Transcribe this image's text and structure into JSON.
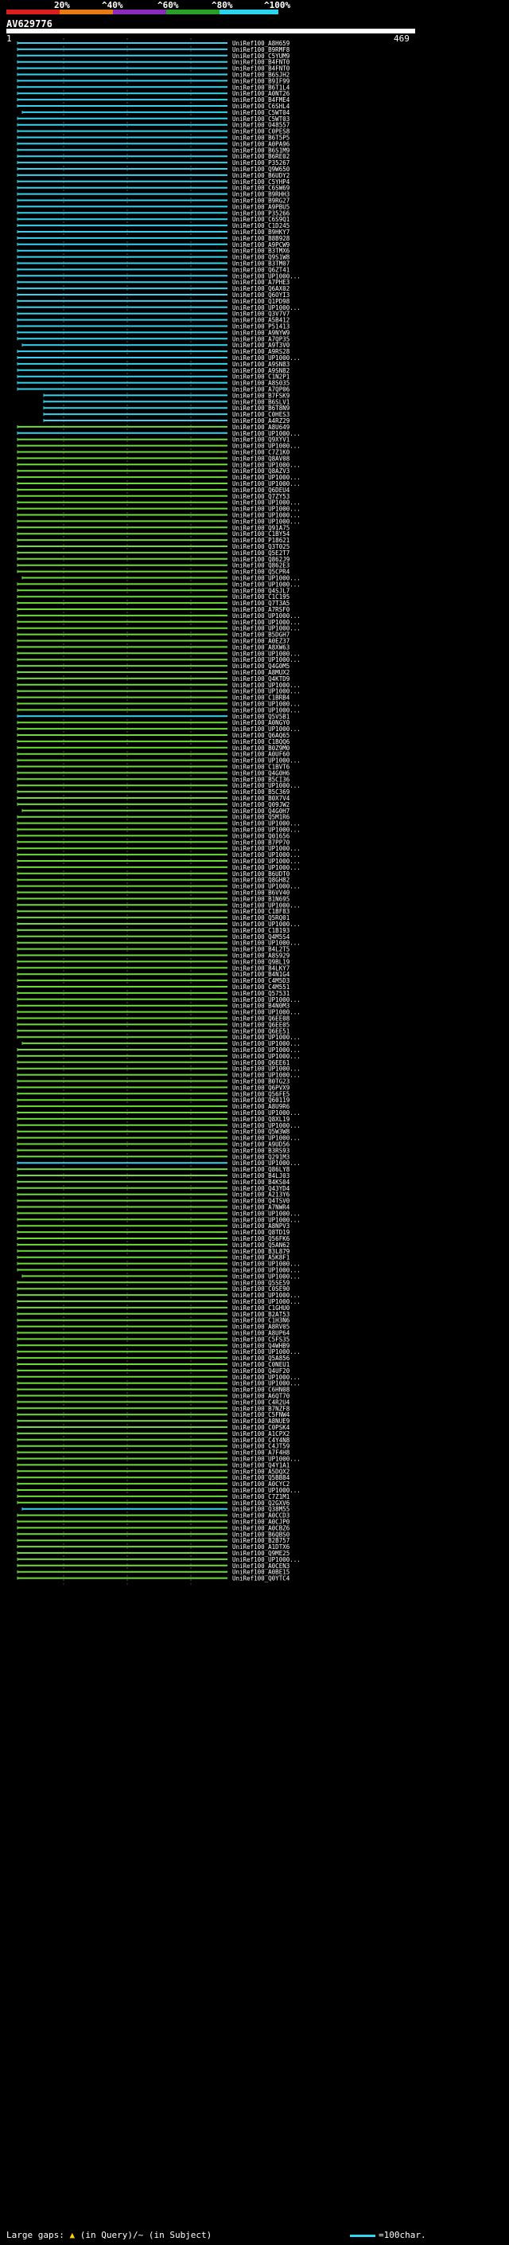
{
  "legend": {
    "labels": [
      "20%",
      "^40%",
      "^60%",
      "^80%",
      "^100%"
    ],
    "colors": [
      "#dc1e1e",
      "#e87a12",
      "#8b2bbd",
      "#28a028",
      "#2ad4ee"
    ]
  },
  "query": {
    "id": "AV629776",
    "start": "1",
    "end": "469"
  },
  "hit_colors": {
    "blue": "#36d3ef",
    "green": "#6cdc36"
  },
  "hits": [
    {
      "label": "UniRef100_A8H659",
      "color": "blue"
    },
    {
      "label": "UniRef100_B9RMF8",
      "color": "blue"
    },
    {
      "label": "UniRef100_C5YUM9",
      "color": "blue"
    },
    {
      "label": "UniRef100_B4FNT0",
      "color": "blue"
    },
    {
      "label": "UniRef100_B4FNT0",
      "color": "blue"
    },
    {
      "label": "UniRef100_B6SJH2",
      "color": "blue"
    },
    {
      "label": "UniRef100_B9IF99",
      "color": "blue"
    },
    {
      "label": "UniRef100_B6T1L4",
      "color": "blue"
    },
    {
      "label": "UniRef100_A0NT26",
      "color": "blue"
    },
    {
      "label": "UniRef100_B4FME4",
      "color": "blue"
    },
    {
      "label": "UniRef100_C6SHL4",
      "color": "blue"
    },
    {
      "label": "UniRef100_C5WT04",
      "color": "blue"
    },
    {
      "label": "UniRef100_C5WT03",
      "color": "blue"
    },
    {
      "label": "UniRef100_O48557",
      "color": "blue"
    },
    {
      "label": "UniRef100_C0PES8",
      "color": "blue"
    },
    {
      "label": "UniRef100_B6T5P5",
      "color": "blue"
    },
    {
      "label": "UniRef100_A0PA96",
      "color": "blue"
    },
    {
      "label": "UniRef100_B6S1M9",
      "color": "blue"
    },
    {
      "label": "UniRef100_B6RE02",
      "color": "blue"
    },
    {
      "label": "UniRef100_P35267",
      "color": "blue"
    },
    {
      "label": "UniRef100_Q9W650",
      "color": "blue"
    },
    {
      "label": "UniRef100_B6UDY2",
      "color": "blue"
    },
    {
      "label": "UniRef100_C5YHP4",
      "color": "blue"
    },
    {
      "label": "UniRef100_C6SW69",
      "color": "blue"
    },
    {
      "label": "UniRef100_B9RHH3",
      "color": "blue"
    },
    {
      "label": "UniRef100_B9RG27",
      "color": "blue"
    },
    {
      "label": "UniRef100_A9PBU5",
      "color": "blue"
    },
    {
      "label": "UniRef100_P35266",
      "color": "blue"
    },
    {
      "label": "UniRef100_C6S9Q1",
      "color": "blue"
    },
    {
      "label": "UniRef100_C1D245",
      "color": "blue"
    },
    {
      "label": "UniRef100_B9HKY7",
      "color": "blue"
    },
    {
      "label": "UniRef100_B8B928",
      "color": "blue"
    },
    {
      "label": "UniRef100_A9PCW9",
      "color": "blue"
    },
    {
      "label": "UniRef100_B3TMX6",
      "color": "blue"
    },
    {
      "label": "UniRef100_Q9S1W8",
      "color": "blue"
    },
    {
      "label": "UniRef100_B3TM07",
      "color": "blue"
    },
    {
      "label": "UniRef100_Q6ZT41",
      "color": "blue"
    },
    {
      "label": "UniRef100_UP1000...",
      "color": "blue"
    },
    {
      "label": "UniRef100_A7PHE3",
      "color": "blue"
    },
    {
      "label": "UniRef100_Q6AX02",
      "color": "blue"
    },
    {
      "label": "UniRef100_Q6OYI3",
      "color": "blue"
    },
    {
      "label": "UniRef100_Q1PD98",
      "color": "blue"
    },
    {
      "label": "UniRef100_UP1000...",
      "color": "blue"
    },
    {
      "label": "UniRef100_Q3V7V7",
      "color": "blue"
    },
    {
      "label": "UniRef100_A5B412",
      "color": "blue"
    },
    {
      "label": "UniRef100_P51413",
      "color": "blue"
    },
    {
      "label": "UniRef100_A9NYW9",
      "color": "blue"
    },
    {
      "label": "UniRef100_A7QP35",
      "color": "blue"
    },
    {
      "label": "UniRef100_A9T3V0",
      "color": "blue"
    },
    {
      "label": "UniRef100_A9RS28",
      "color": "blue"
    },
    {
      "label": "UniRef100_UP1000...",
      "color": "blue"
    },
    {
      "label": "UniRef100_A9SN83",
      "color": "blue"
    },
    {
      "label": "UniRef100_A9SN82",
      "color": "blue"
    },
    {
      "label": "UniRef100_C1N2P1",
      "color": "blue"
    },
    {
      "label": "UniRef100_A8S035",
      "color": "blue"
    },
    {
      "label": "UniRef100_A7QP06",
      "color": "blue"
    },
    {
      "label": "UniRef100_B7FSK9",
      "color": "blue"
    },
    {
      "label": "UniRef100_B6SLV1",
      "color": "blue"
    },
    {
      "label": "UniRef100_B6T8N9",
      "color": "blue"
    },
    {
      "label": "UniRef100_C0HES3",
      "color": "blue"
    },
    {
      "label": "UniRef100_A4RZ29",
      "color": "blue"
    },
    {
      "label": "UniRef100_A8U649",
      "color": "green"
    },
    {
      "label": "UniRef100_UP1000...",
      "color": "blue"
    },
    {
      "label": "UniRef100_Q9XYV1",
      "color": "green"
    },
    {
      "label": "UniRef100_UP1000...",
      "color": "green"
    },
    {
      "label": "UniRef100_C7Z1K0",
      "color": "green"
    },
    {
      "label": "UniRef100_Q8AV08",
      "color": "green"
    },
    {
      "label": "UniRef100_UP1000...",
      "color": "green"
    },
    {
      "label": "UniRef100_Q8AZV3",
      "color": "green"
    },
    {
      "label": "UniRef100_UP1000...",
      "color": "green"
    },
    {
      "label": "UniRef100_UP1000...",
      "color": "green"
    },
    {
      "label": "UniRef100_Q6DEU4",
      "color": "green"
    },
    {
      "label": "UniRef100_Q7ZY53",
      "color": "green"
    },
    {
      "label": "UniRef100_UP1000...",
      "color": "green"
    },
    {
      "label": "UniRef100_UP1000...",
      "color": "green"
    },
    {
      "label": "UniRef100_UP1000...",
      "color": "green"
    },
    {
      "label": "UniRef100_UP1000...",
      "color": "green"
    },
    {
      "label": "UniRef100_Q91A75",
      "color": "green"
    },
    {
      "label": "UniRef100_C1BY54",
      "color": "green"
    },
    {
      "label": "UniRef100_P18621",
      "color": "green"
    },
    {
      "label": "UniRef100_Q3T025",
      "color": "green"
    },
    {
      "label": "UniRef100_Q5E2T7",
      "color": "green"
    },
    {
      "label": "UniRef100_Q862J9",
      "color": "green"
    },
    {
      "label": "UniRef100_Q862E3",
      "color": "green"
    },
    {
      "label": "UniRef100_Q5CPR4",
      "color": "green"
    },
    {
      "label": "UniRef100_UP1000...",
      "color": "green"
    },
    {
      "label": "UniRef100_UP1000...",
      "color": "green"
    },
    {
      "label": "UniRef100_Q4SJL7",
      "color": "green"
    },
    {
      "label": "UniRef100_C1C195",
      "color": "green"
    },
    {
      "label": "UniRef100_Q7T3A5",
      "color": "green"
    },
    {
      "label": "UniRef100_A7RSF0",
      "color": "green"
    },
    {
      "label": "UniRef100_UP1000...",
      "color": "green"
    },
    {
      "label": "UniRef100_UP1000...",
      "color": "green"
    },
    {
      "label": "UniRef100_UP1000...",
      "color": "green"
    },
    {
      "label": "UniRef100_B5DGH7",
      "color": "green"
    },
    {
      "label": "UniRef100_A0EZ37",
      "color": "green"
    },
    {
      "label": "UniRef100_A8XW63",
      "color": "green"
    },
    {
      "label": "UniRef100_UP1000...",
      "color": "green"
    },
    {
      "label": "UniRef100_UP1000...",
      "color": "green"
    },
    {
      "label": "UniRef100_Q4G0M5",
      "color": "green"
    },
    {
      "label": "UniRef100_A8MUX2",
      "color": "green"
    },
    {
      "label": "UniRef100_Q4KTD9",
      "color": "green"
    },
    {
      "label": "UniRef100_UP1000...",
      "color": "green"
    },
    {
      "label": "UniRef100_UP1000...",
      "color": "green"
    },
    {
      "label": "UniRef100_C1BRB4",
      "color": "green"
    },
    {
      "label": "UniRef100_UP1000...",
      "color": "green"
    },
    {
      "label": "UniRef100_UP1000...",
      "color": "green"
    },
    {
      "label": "UniRef100_Q5V5B1",
      "color": "blue"
    },
    {
      "label": "UniRef100_A0NGY0",
      "color": "green"
    },
    {
      "label": "UniRef100_UP1000...",
      "color": "green"
    },
    {
      "label": "UniRef100_Q6AQ65",
      "color": "green"
    },
    {
      "label": "UniRef100_C1BQQ6",
      "color": "green"
    },
    {
      "label": "UniRef100_B0Z9M0",
      "color": "green"
    },
    {
      "label": "UniRef100_A0UF60",
      "color": "green"
    },
    {
      "label": "UniRef100_UP1000...",
      "color": "green"
    },
    {
      "label": "UniRef100_C1BVT6",
      "color": "green"
    },
    {
      "label": "UniRef100_Q4G0H6",
      "color": "green"
    },
    {
      "label": "UniRef100_B5CI36",
      "color": "green"
    },
    {
      "label": "UniRef100_UP1000...",
      "color": "green"
    },
    {
      "label": "UniRef100_B5C369",
      "color": "green"
    },
    {
      "label": "UniRef100_B0X7V4",
      "color": "green"
    },
    {
      "label": "UniRef100_Q09JW2",
      "color": "green"
    },
    {
      "label": "UniRef100_Q4G0H7",
      "color": "green"
    },
    {
      "label": "UniRef100_Q5M1R6",
      "color": "green"
    },
    {
      "label": "UniRef100_UP1000...",
      "color": "green"
    },
    {
      "label": "UniRef100_UP1000...",
      "color": "green"
    },
    {
      "label": "UniRef100_Q01656",
      "color": "green"
    },
    {
      "label": "UniRef100_B7PP70",
      "color": "green"
    },
    {
      "label": "UniRef100_UP1000...",
      "color": "green"
    },
    {
      "label": "UniRef100_UP1000...",
      "color": "green"
    },
    {
      "label": "UniRef100_UP1000...",
      "color": "green"
    },
    {
      "label": "UniRef100_UP1000...",
      "color": "green"
    },
    {
      "label": "UniRef100_B6UDT0",
      "color": "green"
    },
    {
      "label": "UniRef100_Q8GH82",
      "color": "green"
    },
    {
      "label": "UniRef100_UP1000...",
      "color": "green"
    },
    {
      "label": "UniRef100_B6VV40",
      "color": "green"
    },
    {
      "label": "UniRef100_B1N695",
      "color": "green"
    },
    {
      "label": "UniRef100_UP1000...",
      "color": "green"
    },
    {
      "label": "UniRef100_C1BF83",
      "color": "green"
    },
    {
      "label": "UniRef100_Q5RQ01",
      "color": "green"
    },
    {
      "label": "UniRef100_UP1000...",
      "color": "green"
    },
    {
      "label": "UniRef100_C1B193",
      "color": "green"
    },
    {
      "label": "UniRef100_Q4M5S4",
      "color": "green"
    },
    {
      "label": "UniRef100_UP1000...",
      "color": "green"
    },
    {
      "label": "UniRef100_B4L2T5",
      "color": "green"
    },
    {
      "label": "UniRef100_A8S929",
      "color": "green"
    },
    {
      "label": "UniRef100_Q9BL19",
      "color": "green"
    },
    {
      "label": "UniRef100_B4LKY7",
      "color": "green"
    },
    {
      "label": "UniRef100_B4N1G4",
      "color": "green"
    },
    {
      "label": "UniRef100_C4M5D3",
      "color": "green"
    },
    {
      "label": "UniRef100_C4M551",
      "color": "green"
    },
    {
      "label": "UniRef100_Q57531",
      "color": "green"
    },
    {
      "label": "UniRef100_UP1000...",
      "color": "green"
    },
    {
      "label": "UniRef100_B4N0M3",
      "color": "green"
    },
    {
      "label": "UniRef100_UP1000...",
      "color": "green"
    },
    {
      "label": "UniRef100_Q6EE08",
      "color": "green"
    },
    {
      "label": "UniRef100_Q6EE05",
      "color": "green"
    },
    {
      "label": "UniRef100_Q6EE51",
      "color": "green"
    },
    {
      "label": "UniRef100_UP1000...",
      "color": "green"
    },
    {
      "label": "UniRef100_UP1000...",
      "color": "green"
    },
    {
      "label": "UniRef100_UP1000...",
      "color": "green"
    },
    {
      "label": "UniRef100_UP1000...",
      "color": "green"
    },
    {
      "label": "UniRef100_Q6EE61",
      "color": "green"
    },
    {
      "label": "UniRef100_UP1000...",
      "color": "green"
    },
    {
      "label": "UniRef100_UP1000...",
      "color": "green"
    },
    {
      "label": "UniRef100_B0TG23",
      "color": "green"
    },
    {
      "label": "UniRef100_Q6PVX9",
      "color": "green"
    },
    {
      "label": "UniRef100_Q56FE5",
      "color": "green"
    },
    {
      "label": "UniRef100_Q60119",
      "color": "green"
    },
    {
      "label": "UniRef100_A8U9R6",
      "color": "green"
    },
    {
      "label": "UniRef100_UP1000...",
      "color": "green"
    },
    {
      "label": "UniRef100_Q8XL19",
      "color": "green"
    },
    {
      "label": "UniRef100_UP1000...",
      "color": "green"
    },
    {
      "label": "UniRef100_Q5W3W8",
      "color": "green"
    },
    {
      "label": "UniRef100_UP1000...",
      "color": "green"
    },
    {
      "label": "UniRef100_A9UD56",
      "color": "green"
    },
    {
      "label": "UniRef100_B3RS93",
      "color": "green"
    },
    {
      "label": "UniRef100_Q291M3",
      "color": "green"
    },
    {
      "label": "UniRef100_UP1000...",
      "color": "blue"
    },
    {
      "label": "UniRef100_Q86LY8",
      "color": "green"
    },
    {
      "label": "UniRef100_B4LJ03",
      "color": "green"
    },
    {
      "label": "UniRef100_B4KS04",
      "color": "green"
    },
    {
      "label": "UniRef100_Q43YD4",
      "color": "green"
    },
    {
      "label": "UniRef100_A213Y6",
      "color": "green"
    },
    {
      "label": "UniRef100_Q4TSV0",
      "color": "green"
    },
    {
      "label": "UniRef100_A7NWR4",
      "color": "green"
    },
    {
      "label": "UniRef100_UP1000...",
      "color": "green"
    },
    {
      "label": "UniRef100_UP1000...",
      "color": "green"
    },
    {
      "label": "UniRef100_A8NPV3",
      "color": "green"
    },
    {
      "label": "UniRef100_Q8TD19",
      "color": "green"
    },
    {
      "label": "UniRef100_Q56FK6",
      "color": "green"
    },
    {
      "label": "UniRef100_Q5AN62",
      "color": "green"
    },
    {
      "label": "UniRef100_B3L879",
      "color": "green"
    },
    {
      "label": "UniRef100_A5K8F1",
      "color": "green"
    },
    {
      "label": "UniRef100_UP1000...",
      "color": "green"
    },
    {
      "label": "UniRef100_UP1000...",
      "color": "green"
    },
    {
      "label": "UniRef100_UP1000...",
      "color": "green"
    },
    {
      "label": "UniRef100_Q5SE59",
      "color": "green"
    },
    {
      "label": "UniRef100_C0SE90",
      "color": "green"
    },
    {
      "label": "UniRef100_UP1000...",
      "color": "green"
    },
    {
      "label": "UniRef100_UP1000...",
      "color": "green"
    },
    {
      "label": "UniRef100_C1GHU0",
      "color": "green"
    },
    {
      "label": "UniRef100_B2AT53",
      "color": "green"
    },
    {
      "label": "UniRef100_C1H3N6",
      "color": "green"
    },
    {
      "label": "UniRef100_A8RV05",
      "color": "green"
    },
    {
      "label": "UniRef100_A8UP64",
      "color": "green"
    },
    {
      "label": "UniRef100_C5FS35",
      "color": "green"
    },
    {
      "label": "UniRef100_Q4WHB9",
      "color": "green"
    },
    {
      "label": "UniRef100_UP1000...",
      "color": "green"
    },
    {
      "label": "UniRef100_Q5A856",
      "color": "green"
    },
    {
      "label": "UniRef100_C0NEU1",
      "color": "green"
    },
    {
      "label": "UniRef100_Q4UF20",
      "color": "green"
    },
    {
      "label": "UniRef100_UP1000...",
      "color": "green"
    },
    {
      "label": "UniRef100_UP1000...",
      "color": "green"
    },
    {
      "label": "UniRef100_C6HN08",
      "color": "green"
    },
    {
      "label": "UniRef100_A6QT70",
      "color": "green"
    },
    {
      "label": "UniRef100_C4R2U4",
      "color": "green"
    },
    {
      "label": "UniRef100_B7NZF8",
      "color": "green"
    },
    {
      "label": "UniRef100_C5FNW4",
      "color": "green"
    },
    {
      "label": "UniRef100_A8NUE9",
      "color": "green"
    },
    {
      "label": "UniRef100_C0PSK4",
      "color": "green"
    },
    {
      "label": "UniRef100_A1CPX2",
      "color": "green"
    },
    {
      "label": "UniRef100_C4Y4N8",
      "color": "green"
    },
    {
      "label": "UniRef100_C4JT59",
      "color": "green"
    },
    {
      "label": "UniRef100_A7F4H8",
      "color": "green"
    },
    {
      "label": "UniRef100_UP1000...",
      "color": "green"
    },
    {
      "label": "UniRef100_Q4Y1A1",
      "color": "green"
    },
    {
      "label": "UniRef100_A5DQX2",
      "color": "green"
    },
    {
      "label": "UniRef100_Q5BB84",
      "color": "green"
    },
    {
      "label": "UniRef100_A0CYC2",
      "color": "green"
    },
    {
      "label": "UniRef100_UP1000...",
      "color": "green"
    },
    {
      "label": "UniRef100_C7Z1M1",
      "color": "green"
    },
    {
      "label": "UniRef100_Q2GXV6",
      "color": "green"
    },
    {
      "label": "UniRef100_Q38M55",
      "color": "blue"
    },
    {
      "label": "UniRef100_A0CCD3",
      "color": "green"
    },
    {
      "label": "UniRef100_A0CJP0",
      "color": "green"
    },
    {
      "label": "UniRef100_A0CBZ6",
      "color": "green"
    },
    {
      "label": "UniRef100_B6QBS0",
      "color": "green"
    },
    {
      "label": "UniRef100_B2B757",
      "color": "green"
    },
    {
      "label": "UniRef100_A1DTX6",
      "color": "green"
    },
    {
      "label": "UniRef100_Q9ME25",
      "color": "green"
    },
    {
      "label": "UniRef100_UP1000...",
      "color": "green"
    },
    {
      "label": "UniRef100_A0CEN3",
      "color": "green"
    },
    {
      "label": "UniRef100_A0BE15",
      "color": "green"
    },
    {
      "label": "UniRef100_Q0YTC4",
      "color": "green"
    }
  ],
  "footer": {
    "gap_label": "Large gaps:",
    "gap_marker": "▲",
    "gap_text": "(in Query)/~ (in Subject)",
    "scale_label": "=100char."
  }
}
